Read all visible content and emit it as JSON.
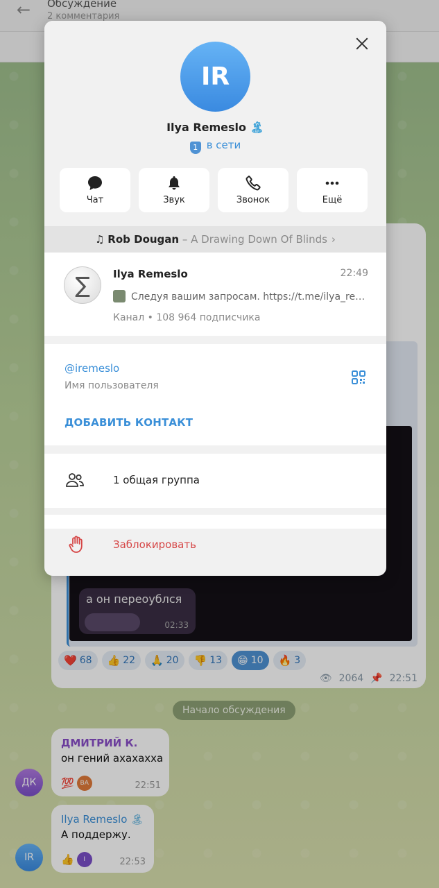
{
  "background": {
    "topbar": {
      "title": "Обсуждение",
      "subtitle": "2 комментария"
    },
    "post": {
      "dark_message": "а он переоублся",
      "dark_time": "02:33",
      "reactions": [
        {
          "glyph": "❤️",
          "count": "68",
          "active": false
        },
        {
          "glyph": "👍",
          "count": "22",
          "active": false
        },
        {
          "glyph": "🙏",
          "count": "20",
          "active": false
        },
        {
          "glyph": "👎",
          "count": "13",
          "active": false
        },
        {
          "glyph": "😁",
          "count": "10",
          "active": true
        },
        {
          "glyph": "🔥",
          "count": "3",
          "active": false
        }
      ],
      "views": "2064",
      "time": "22:51"
    },
    "divider": "Начало обсуждения",
    "comments": [
      {
        "author": "ДМИТРИЙ К.",
        "text": "он гений ахахахха",
        "reaction": "💯",
        "reactor": "ВА",
        "time": "22:51",
        "avatar": "ДК"
      },
      {
        "author": "Ilya Remeslo",
        "text": "А поддержу.",
        "reaction": "👍",
        "reactor": "I",
        "time": "22:53",
        "avatar": "IR"
      }
    ]
  },
  "profile": {
    "initials": "IR",
    "name": "Ilya Remeslo",
    "name_emoji": "🏝",
    "online_badge": "1",
    "status": "в сети",
    "actions": [
      {
        "label": "Чат",
        "icon": "chat-icon"
      },
      {
        "label": "Звук",
        "icon": "bell-icon"
      },
      {
        "label": "Звонок",
        "icon": "phone-icon"
      },
      {
        "label": "Ещё",
        "icon": "more-icon"
      }
    ],
    "music": {
      "artist": "Rob Dougan",
      "song": "– A Drawing Down Of Blinds"
    },
    "channel": {
      "name": "Ilya Remeslo",
      "time": "22:49",
      "preview": "Следуя вашим запросам. https://t.me/ilya_remeslo",
      "subscribers": "Канал • 108 964 подписчика"
    },
    "username": "@iremeslo",
    "username_label": "Имя пользователя",
    "add_contact": "ДОБАВИТЬ КОНТАКТ",
    "groups": "1 общая группа",
    "block": "Заблокировать"
  }
}
